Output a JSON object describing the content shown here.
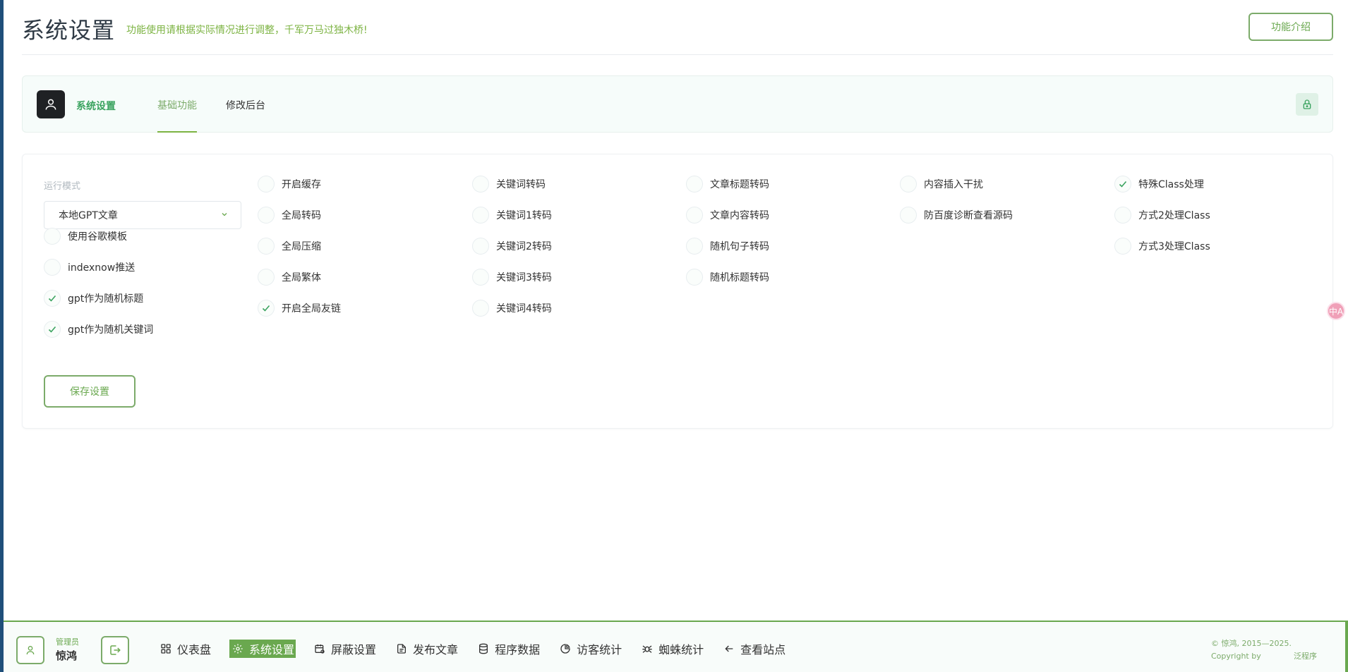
{
  "header": {
    "title": "系统设置",
    "subtitle": "功能使用请根据实际情况进行调整，千军万马过独木桥!",
    "intro_button": "功能介绍"
  },
  "tabs": {
    "section_label": "系统设置",
    "items": [
      {
        "label": "基础功能",
        "active": true
      },
      {
        "label": "修改后台",
        "active": false
      }
    ]
  },
  "settings": {
    "mode_label": "运行模式",
    "mode_value": "本地GPT文章",
    "left_options": [
      {
        "label": "使用谷歌模板",
        "checked": false
      },
      {
        "label": "indexnow推送",
        "checked": false
      },
      {
        "label": "gpt作为随机标题",
        "checked": true
      },
      {
        "label": "gpt作为随机关键词",
        "checked": true
      }
    ],
    "columns": [
      [
        {
          "label": "开启缓存",
          "checked": false
        },
        {
          "label": "全局转码",
          "checked": false
        },
        {
          "label": "全局压缩",
          "checked": false
        },
        {
          "label": "全局繁体",
          "checked": false
        },
        {
          "label": "开启全局友链",
          "checked": true
        }
      ],
      [
        {
          "label": "关键词转码",
          "checked": false
        },
        {
          "label": "关键词1转码",
          "checked": false
        },
        {
          "label": "关键词2转码",
          "checked": false
        },
        {
          "label": "关键词3转码",
          "checked": false
        },
        {
          "label": "关键词4转码",
          "checked": false
        }
      ],
      [
        {
          "label": "文章标题转码",
          "checked": false
        },
        {
          "label": "文章内容转码",
          "checked": false
        },
        {
          "label": "随机句子转码",
          "checked": false
        },
        {
          "label": "随机标题转码",
          "checked": false
        }
      ],
      [
        {
          "label": "内容插入干扰",
          "checked": false
        },
        {
          "label": "防百度诊断查看源码",
          "checked": false
        }
      ],
      [
        {
          "label": "特殊Class处理",
          "checked": true
        },
        {
          "label": "方式2处理Class",
          "checked": false
        },
        {
          "label": "方式3处理Class",
          "checked": false
        }
      ]
    ],
    "save_button": "保存设置"
  },
  "translate_badge": "中A",
  "bottom": {
    "user_role": "管理员",
    "user_name": "惊鸿",
    "nav": [
      {
        "label": "仪表盘",
        "icon": "grid-icon",
        "active": false
      },
      {
        "label": "系统设置",
        "icon": "gear-icon",
        "active": true
      },
      {
        "label": "屏蔽设置",
        "icon": "calendar-block-icon",
        "active": false
      },
      {
        "label": "发布文章",
        "icon": "document-icon",
        "active": false
      },
      {
        "label": "程序数据",
        "icon": "database-icon",
        "active": false
      },
      {
        "label": "访客统计",
        "icon": "pie-chart-icon",
        "active": false
      },
      {
        "label": "蜘蛛统计",
        "icon": "spider-icon",
        "active": false
      },
      {
        "label": "查看站点",
        "icon": "arrow-left-icon",
        "active": false
      }
    ],
    "copyright_line1": "© 惊鸿, 2015—2025.",
    "copyright_line2a": "Copyright by",
    "copyright_line2b": "泛程序"
  },
  "colors": {
    "accent": "#6aa84f",
    "accent_text": "#3aa35f",
    "dark": "#1f2124",
    "stripe": "#1f4f7a"
  }
}
